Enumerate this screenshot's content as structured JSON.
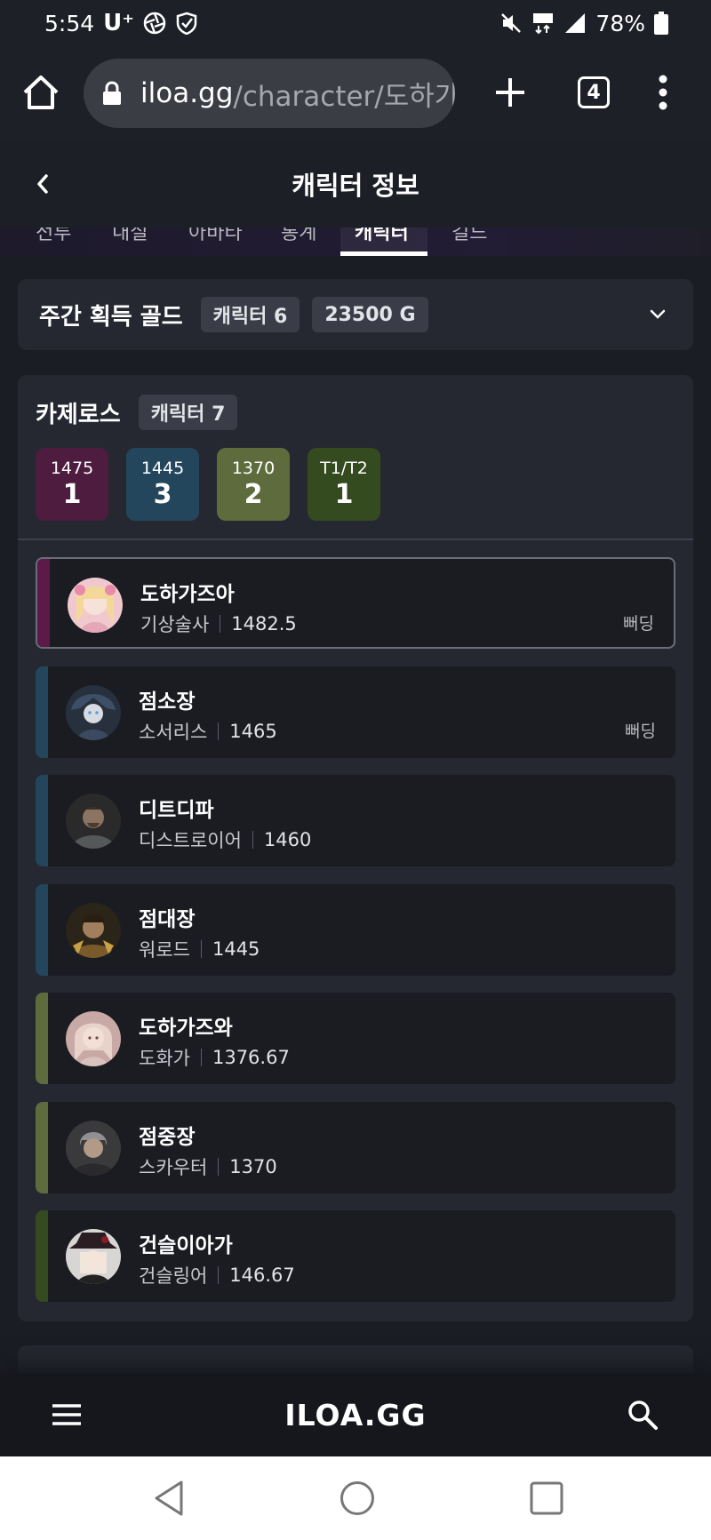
{
  "status_bar": {
    "time": "5:54",
    "carrier": "U⁺",
    "battery": "78%"
  },
  "browser": {
    "url_host": "iloa.gg",
    "url_path": "/character/도하가즈",
    "tab_count": "4"
  },
  "header": {
    "title": "캐릭터 정보"
  },
  "tabs": [
    {
      "label": "전투"
    },
    {
      "label": "내실"
    },
    {
      "label": "아바타"
    },
    {
      "label": "통계"
    },
    {
      "label": "캐릭터",
      "active": true
    },
    {
      "label": "길드"
    }
  ],
  "weekly_gold": {
    "title": "주간 획득 골드",
    "character_chip": "캐릭터 6",
    "gold_chip": "23500 G"
  },
  "server": {
    "name": "카제로스",
    "character_chip": "캐릭터 7",
    "tiers": [
      {
        "label": "1475",
        "count": "1",
        "color": "#4d1c3f"
      },
      {
        "label": "1445",
        "count": "3",
        "color": "#23465d"
      },
      {
        "label": "1370",
        "count": "2",
        "color": "#5e6b3d"
      },
      {
        "label": "T1/T2",
        "count": "1",
        "color": "#344a1f"
      }
    ],
    "characters": [
      {
        "name": "도하가즈아",
        "class": "기상술사",
        "level": "1482.5",
        "tag": "뻐딩",
        "accent": "#5b1a47",
        "selected": true
      },
      {
        "name": "점소장",
        "class": "소서리스",
        "level": "1465",
        "tag": "뻐딩",
        "accent": "#23465d"
      },
      {
        "name": "디트디파",
        "class": "디스트로이어",
        "level": "1460",
        "tag": "",
        "accent": "#23465d"
      },
      {
        "name": "점대장",
        "class": "워로드",
        "level": "1445",
        "tag": "",
        "accent": "#23465d"
      },
      {
        "name": "도하가즈와",
        "class": "도화가",
        "level": "1376.67",
        "tag": "",
        "accent": "#5e6b3d"
      },
      {
        "name": "점중장",
        "class": "스카우터",
        "level": "1370",
        "tag": "",
        "accent": "#5e6b3d"
      },
      {
        "name": "건슬이아가",
        "class": "건슬링어",
        "level": "146.67",
        "tag": "",
        "accent": "#344a1f"
      }
    ]
  },
  "site_nav": {
    "logo": "ILOA.GG"
  }
}
